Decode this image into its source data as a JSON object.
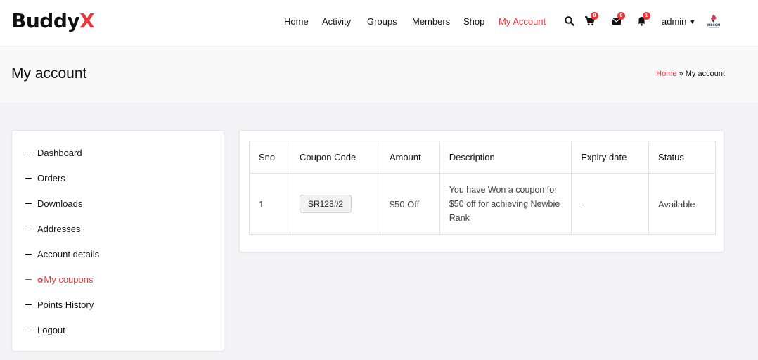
{
  "brand": {
    "name_main": "Buddy",
    "name_accent": "X",
    "accent_color": "#e8383d"
  },
  "nav": {
    "items": [
      {
        "label": "Home"
      },
      {
        "label": "Activity"
      },
      {
        "label": "Groups"
      },
      {
        "label": "Members"
      },
      {
        "label": "Shop"
      },
      {
        "label": "My Account",
        "active": true
      }
    ]
  },
  "header_icons": {
    "search": "search-icon",
    "cart": {
      "icon": "cart-icon",
      "count": "0"
    },
    "messages": {
      "icon": "envelope-icon",
      "count": "0"
    },
    "notifications": {
      "icon": "bell-icon",
      "count": "1"
    }
  },
  "user": {
    "name": "admin",
    "avatar_text": "WBCOM"
  },
  "page": {
    "title": "My account"
  },
  "breadcrumb": {
    "home": "Home",
    "separator": "»",
    "current": "My account"
  },
  "sidebar": {
    "items": [
      {
        "label": "Dashboard"
      },
      {
        "label": "Orders"
      },
      {
        "label": "Downloads"
      },
      {
        "label": "Addresses"
      },
      {
        "label": "Account details"
      },
      {
        "label": "My coupons",
        "active": true
      },
      {
        "label": "Points History"
      },
      {
        "label": "Logout"
      }
    ]
  },
  "coupons_table": {
    "headers": [
      "Sno",
      "Coupon Code",
      "Amount",
      "Description",
      "Expiry date",
      "Status"
    ],
    "rows": [
      {
        "sno": "1",
        "code": "SR123#2",
        "amount": "$50 Off",
        "description": "You have Won a coupon for $50 off for achieving Newbie Rank",
        "expiry": "-",
        "status": "Available"
      }
    ]
  }
}
